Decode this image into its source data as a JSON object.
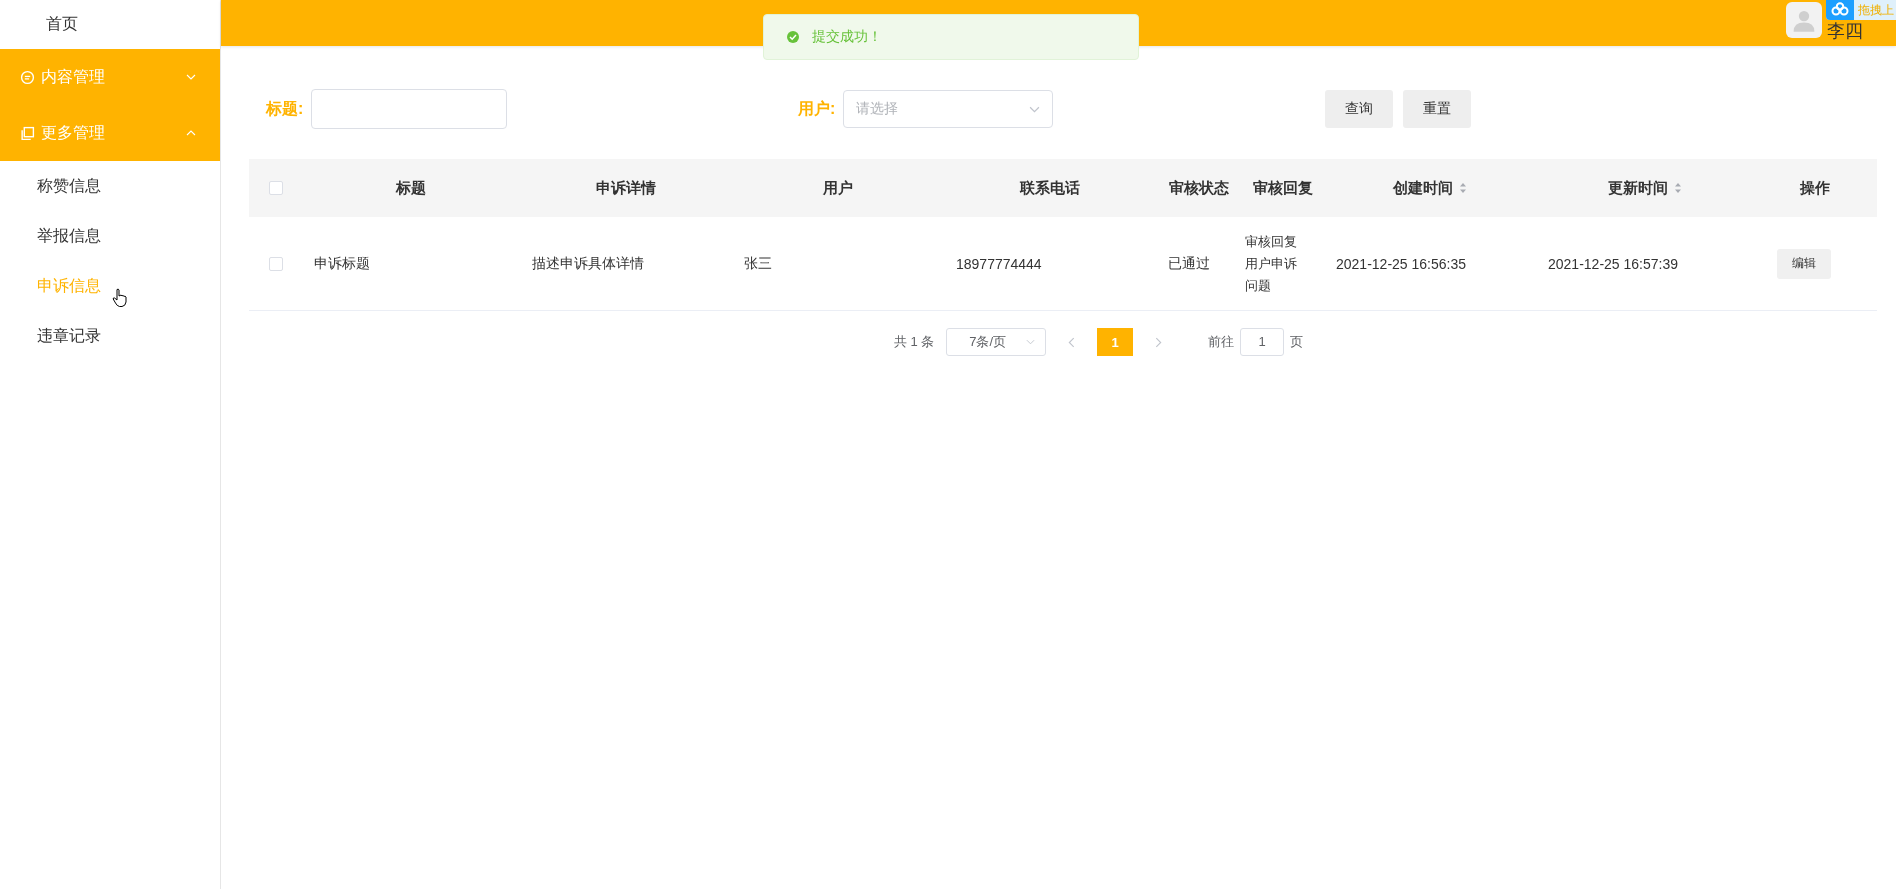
{
  "sidebar": {
    "items": [
      {
        "label": "首页",
        "kind": "link"
      },
      {
        "label": "内容管理",
        "kind": "group",
        "expanded": false
      },
      {
        "label": "更多管理",
        "kind": "group",
        "expanded": true,
        "children": [
          {
            "label": "称赞信息",
            "selected": false
          },
          {
            "label": "举报信息",
            "selected": false
          },
          {
            "label": "申诉信息",
            "selected": true
          },
          {
            "label": "违章记录",
            "selected": false
          }
        ]
      }
    ]
  },
  "header": {
    "user": {
      "name": "李四"
    },
    "extension": {
      "label": "拖拽上"
    }
  },
  "toast": {
    "message": "提交成功！"
  },
  "filters": [
    {
      "label": "标题:",
      "kind": "input"
    },
    {
      "label": "用户:",
      "kind": "select",
      "placeholder": "请选择"
    }
  ],
  "buttons": [
    "查询",
    "重置"
  ],
  "table": {
    "all_checked": false,
    "columns": [
      {
        "label": "标题",
        "sortable": false
      },
      {
        "label": "申诉详情",
        "sortable": false
      },
      {
        "label": "用户",
        "sortable": false
      },
      {
        "label": "联系电话",
        "sortable": false
      },
      {
        "label": "审核状态",
        "sortable": false
      },
      {
        "label": "审核回复",
        "sortable": false
      },
      {
        "label": "创建时间",
        "sortable": true
      },
      {
        "label": "更新时间",
        "sortable": true
      },
      {
        "label": "操作",
        "sortable": false
      }
    ],
    "rows": [
      {
        "checked": false,
        "cells": [
          "申诉标题",
          "描述申诉具体详情",
          "张三",
          "18977774444",
          "已通过",
          "审核回复用户申诉问题",
          "2021-12-25 16:56:35",
          "2021-12-25 16:57:39"
        ],
        "action": "编辑"
      }
    ]
  },
  "pagination": {
    "total": "共 1 条",
    "page_size": "7条/页",
    "pages": [
      {
        "label": "1",
        "selected": true
      }
    ],
    "goto_label": "前往",
    "goto_value": "1",
    "goto_suffix": "页"
  }
}
